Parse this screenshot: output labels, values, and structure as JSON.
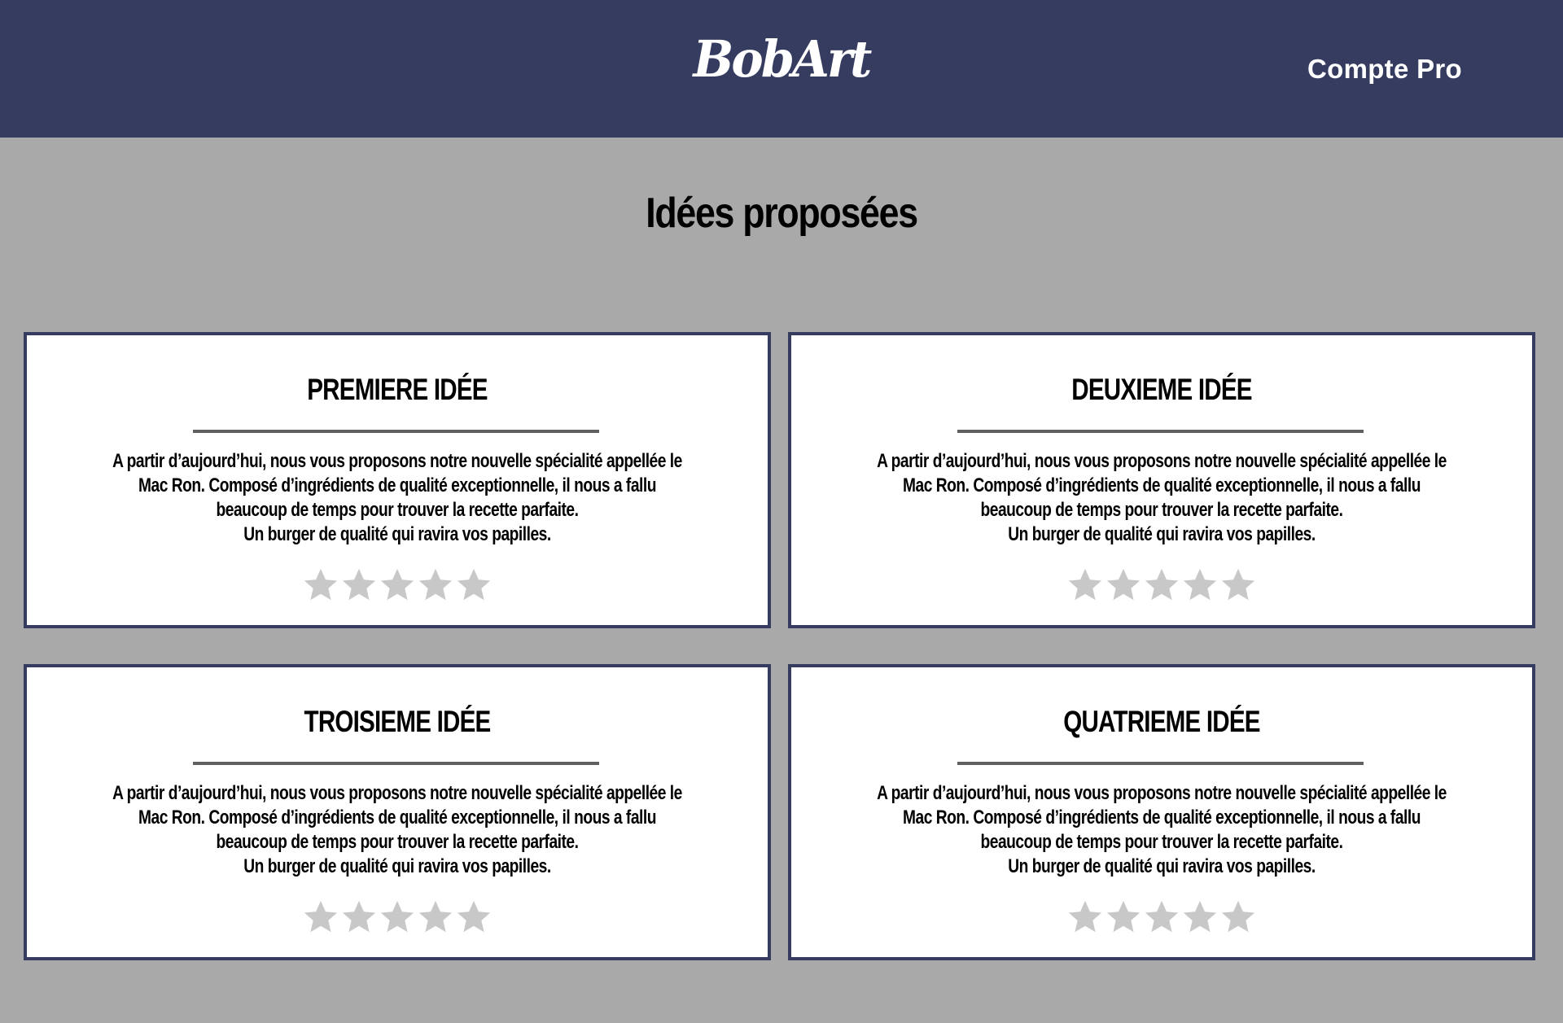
{
  "header": {
    "logo": "BobArt",
    "account_link": "Compte Pro",
    "background_color": "#353c60"
  },
  "page": {
    "title": "Idées proposées",
    "background_color": "#a9a9a9"
  },
  "ideas": [
    {
      "title": "PREMIERE IDÉE",
      "text_lines": [
        "A partir d’aujourd’hui, nous vous proposons notre nouvelle spécialité appellée le",
        "Mac Ron. Composé d’ingrédients de qualité exceptionnelle, il nous a fallu",
        "beaucoup de temps pour trouver la recette parfaite.",
        "Un burger de qualité qui ravira vos papilles."
      ],
      "rating": 0,
      "rating_max": 5
    },
    {
      "title": "DEUXIEME IDÉE",
      "text_lines": [
        "A partir d’aujourd’hui, nous vous proposons notre nouvelle spécialité appellée le",
        "Mac Ron. Composé d’ingrédients de qualité exceptionnelle, il nous a fallu",
        "beaucoup de temps pour trouver la recette parfaite.",
        "Un burger de qualité qui ravira vos papilles."
      ],
      "rating": 0,
      "rating_max": 5
    },
    {
      "title": "TROISIEME IDÉE",
      "text_lines": [
        "A partir d’aujourd’hui, nous vous proposons notre nouvelle spécialité appellée le",
        "Mac Ron. Composé d’ingrédients de qualité exceptionnelle, il nous a fallu",
        "beaucoup de temps pour trouver la recette parfaite.",
        "Un burger de qualité qui ravira vos papilles."
      ],
      "rating": 0,
      "rating_max": 5
    },
    {
      "title": "QUATRIEME IDÉE",
      "text_lines": [
        "A partir d’aujourd’hui, nous vous proposons notre nouvelle spécialité appellée le",
        "Mac Ron. Composé d’ingrédients de qualité exceptionnelle, il nous a fallu",
        "beaucoup de temps pour trouver la recette parfaite.",
        "Un burger de qualité qui ravira vos papilles."
      ],
      "rating": 0,
      "rating_max": 5
    }
  ],
  "icons": {
    "star": "star-icon"
  },
  "colors": {
    "star_empty": "#c8c8c8",
    "star_filled": "#f2b01e",
    "card_border": "#353c60",
    "divider": "#606060"
  }
}
